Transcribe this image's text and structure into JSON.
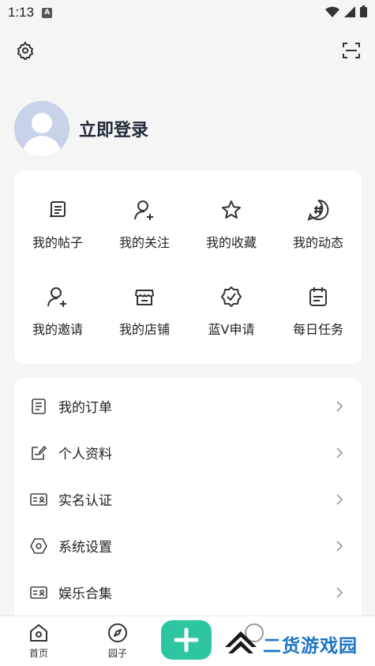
{
  "status_bar": {
    "time": "1:13",
    "notif_letter": "A"
  },
  "profile": {
    "login_text": "立即登录"
  },
  "grid": {
    "items": [
      {
        "label": "我的帖子",
        "icon": "post-icon"
      },
      {
        "label": "我的关注",
        "icon": "follow-icon"
      },
      {
        "label": "我的收藏",
        "icon": "star-icon"
      },
      {
        "label": "我的动态",
        "icon": "hashtag-icon"
      },
      {
        "label": "我的邀请",
        "icon": "invite-icon"
      },
      {
        "label": "我的店铺",
        "icon": "shop-icon"
      },
      {
        "label": "蓝V申请",
        "icon": "verified-badge-icon"
      },
      {
        "label": "每日任务",
        "icon": "calendar-icon"
      }
    ]
  },
  "list": {
    "items": [
      {
        "label": "我的订单",
        "icon": "order-icon"
      },
      {
        "label": "个人资料",
        "icon": "edit-profile-icon"
      },
      {
        "label": "实名认证",
        "icon": "id-card-icon"
      },
      {
        "label": "系统设置",
        "icon": "hexagon-settings-icon"
      },
      {
        "label": "娱乐合集",
        "icon": "collection-icon"
      }
    ]
  },
  "tabbar": {
    "home_label": "首页",
    "garden_label": "园子"
  },
  "watermark": {
    "text": "二货游戏园"
  },
  "colors": {
    "accent": "#2ec6a0",
    "watermark": "#1d76c4",
    "background": "#f5f5f5"
  }
}
